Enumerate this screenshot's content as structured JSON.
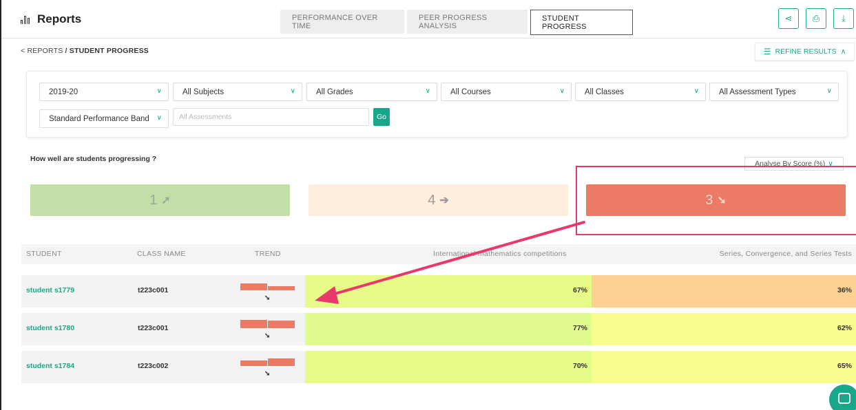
{
  "app": {
    "title": "Reports"
  },
  "tabs": [
    {
      "label": "PERFORMANCE OVER TIME",
      "active": false
    },
    {
      "label": "PEER PROGRESS ANALYSIS",
      "active": false
    },
    {
      "label": "STUDENT PROGRESS",
      "active": true
    }
  ],
  "header_actions": [
    {
      "icon": "share-icon",
      "glyph": "⋖"
    },
    {
      "icon": "print-icon",
      "glyph": "⎙"
    },
    {
      "icon": "download-icon",
      "glyph": "⤓"
    }
  ],
  "breadcrumb": {
    "parent": "< REPORTS",
    "separator": " / ",
    "current": "STUDENT PROGRESS"
  },
  "refine": {
    "label": "REFINE RESULTS",
    "icon": "filter-icon",
    "chevron": "∧"
  },
  "filters": {
    "year": "2019-20",
    "subjects": "All Subjects",
    "grades": "All Grades",
    "courses": "All Courses",
    "classes": "All Classes",
    "assessment_types": "All Assessment Types",
    "performance_band": "Standard Performance Band",
    "assessments_placeholder": "All Assessments",
    "go_label": "Go"
  },
  "question": "How well are students progressing ?",
  "analyse_by": {
    "label": "Analyse By Score (%)",
    "chevron": "∨"
  },
  "summary_cards": [
    {
      "count": "1",
      "arrow": "➚",
      "direction": "up",
      "bg": "#c2dfa8",
      "fg": "#9aa89a"
    },
    {
      "count": "4",
      "arrow": "➔",
      "direction": "flat",
      "bg": "#fdeedd",
      "fg": "#9a9a9a"
    },
    {
      "count": "3",
      "arrow": "➘",
      "direction": "down",
      "bg": "#ec7b65",
      "fg": "#f6d7cf"
    }
  ],
  "table": {
    "headers": {
      "student": "STUDENT",
      "class_name": "CLASS NAME",
      "trend": "TREND",
      "col1": "International mathematics competitions",
      "col2": "Series, Convergence, and Series Tests"
    },
    "rows": [
      {
        "student": "student s1779",
        "class_name": "t223c001",
        "trend_arrow": "➘",
        "col1": "67%",
        "col2": "36%",
        "col1_bg": "#e6fc86",
        "col2_bg": "#fcd191",
        "bars": [
          10,
          6
        ]
      },
      {
        "student": "student s1780",
        "class_name": "t223c001",
        "trend_arrow": "➘",
        "col1": "77%",
        "col2": "62%",
        "col1_bg": "#e0fc8e",
        "col2_bg": "#f8fd8d",
        "bars": [
          12,
          11
        ]
      },
      {
        "student": "student s1784",
        "class_name": "t223c002",
        "trend_arrow": "➘",
        "col1": "70%",
        "col2": "65%",
        "col1_bg": "#e6fc86",
        "col2_bg": "#f8fd8d",
        "bars": [
          8,
          11
        ]
      }
    ]
  },
  "colors": {
    "accent": "#1aa68a",
    "annotation": "#e8396a"
  }
}
